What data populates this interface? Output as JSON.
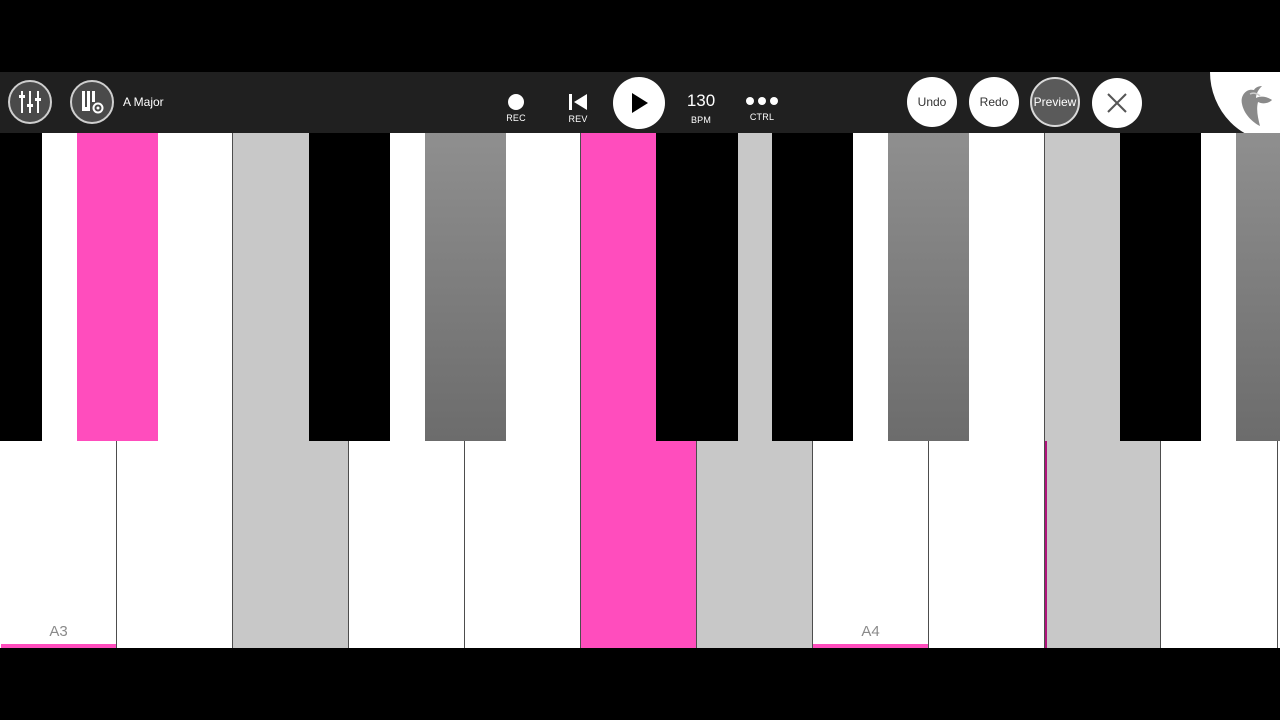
{
  "toolbar": {
    "scale_label": "A Major",
    "rec_label": "REC",
    "rev_label": "REV",
    "bpm_value": "130",
    "bpm_label": "BPM",
    "ctrl_label": "CTRL",
    "undo_label": "Undo",
    "redo_label": "Redo",
    "preview_label": "Preview",
    "icons": [
      "mixer-sliders-icon",
      "piano-settings-icon",
      "record-icon",
      "rewind-icon",
      "play-icon",
      "more-dots-icon",
      "close-icon",
      "fruit-logo-icon"
    ]
  },
  "keyboard": {
    "note_labels": [
      "A3",
      "A4"
    ],
    "white_key_states": [
      "marked",
      "normal",
      "gray",
      "normal",
      "normal",
      "pink",
      "gray",
      "marked",
      "normal",
      "gray",
      "normal"
    ],
    "black_key_states": [
      "black",
      "pink",
      "gray-light",
      "black",
      "gray",
      "pink",
      "black",
      "gray-light",
      "black",
      "gray",
      "gray-light",
      "black",
      "gray"
    ],
    "colors": {
      "highlight": "#ff4dbd",
      "scale_key": "#c8c8c8",
      "scale_black_key": "#808080",
      "toolbar": "#202020"
    }
  }
}
